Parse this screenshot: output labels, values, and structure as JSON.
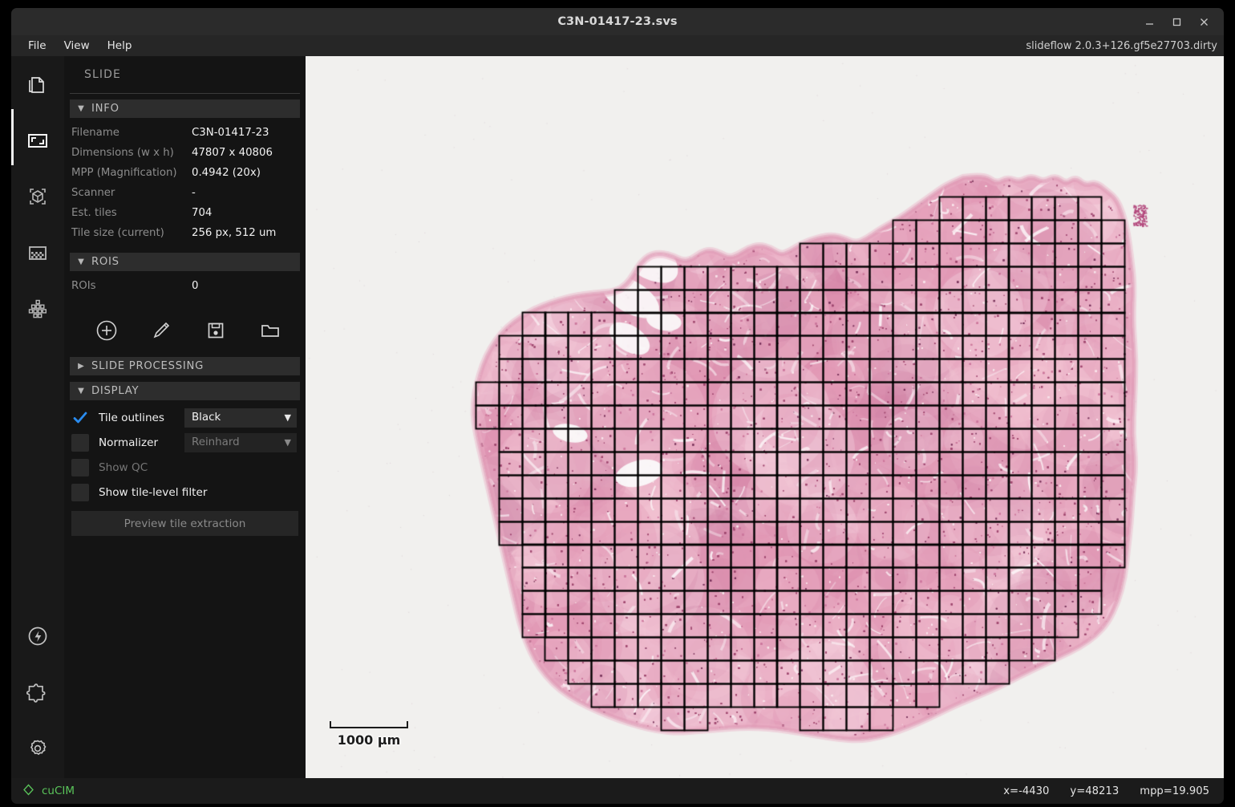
{
  "window": {
    "title": "C3N-01417-23.svs",
    "controls": {
      "minimize": "minimize-icon",
      "maximize": "maximize-icon",
      "close": "close-icon"
    }
  },
  "menubar": {
    "items": [
      {
        "label": "File"
      },
      {
        "label": "View"
      },
      {
        "label": "Help"
      }
    ],
    "version": "slideflow 2.0.3+126.gf5e27703.dirty"
  },
  "rail": {
    "items": [
      {
        "name": "slide-icon",
        "selected": false
      },
      {
        "name": "viewport-icon",
        "selected": true
      },
      {
        "name": "model-icon",
        "selected": false
      },
      {
        "name": "heatmap-icon",
        "selected": false
      },
      {
        "name": "mosaic-icon",
        "selected": false
      }
    ],
    "bottom_items": [
      {
        "name": "performance-icon"
      },
      {
        "name": "extensions-icon"
      },
      {
        "name": "settings-icon"
      }
    ]
  },
  "panel": {
    "title": "SLIDE",
    "info": {
      "header": "INFO",
      "expanded": true,
      "rows": [
        {
          "key": "Filename",
          "value": "C3N-01417-23"
        },
        {
          "key": "Dimensions (w x h)",
          "value": "47807 x 40806"
        },
        {
          "key": "MPP (Magnification)",
          "value": "0.4942 (20x)"
        },
        {
          "key": "Scanner",
          "value": "-"
        },
        {
          "key": "Est. tiles",
          "value": "704"
        },
        {
          "key": "Tile size (current)",
          "value": "256 px, 512 um"
        }
      ]
    },
    "rois": {
      "header": "ROIS",
      "expanded": true,
      "rows": [
        {
          "key": "ROIs",
          "value": "0"
        }
      ],
      "tools": [
        {
          "name": "add-roi-button",
          "icon": "plus-circle-icon"
        },
        {
          "name": "edit-roi-button",
          "icon": "pencil-icon"
        },
        {
          "name": "save-roi-button",
          "icon": "floppy-disk-icon"
        },
        {
          "name": "load-roi-button",
          "icon": "folder-icon"
        }
      ]
    },
    "slide_processing": {
      "header": "SLIDE PROCESSING",
      "expanded": false
    },
    "display": {
      "header": "DISPLAY",
      "expanded": true,
      "tile_outlines": {
        "label": "Tile outlines",
        "checked": true,
        "dropdown_value": "Black",
        "enabled": true
      },
      "normalizer": {
        "label": "Normalizer",
        "checked": false,
        "dropdown_value": "Reinhard",
        "enabled": false
      },
      "show_qc": {
        "label": "Show QC",
        "checked": false,
        "enabled": false
      },
      "show_tile_filter": {
        "label": "Show tile-level filter",
        "checked": false,
        "enabled": true
      },
      "preview_button": "Preview tile extraction"
    }
  },
  "viewport": {
    "scalebar": {
      "label": "1000 µm"
    }
  },
  "statusbar": {
    "backend": "cuCIM",
    "backend_icon": "diamond-icon",
    "x": "x=-4430",
    "y": "y=48213",
    "mpp": "mpp=19.905"
  },
  "colors": {
    "accent_check": "#2a8cf0",
    "status_green": "#5ac45a",
    "panel_bg": "#141414",
    "rail_bg": "#191919",
    "titlebar_bg": "#2b2b2b",
    "viewport_bg": "#f1f0ee",
    "tile_outline": "#000000",
    "tissue_pink": "#e8a8be"
  }
}
